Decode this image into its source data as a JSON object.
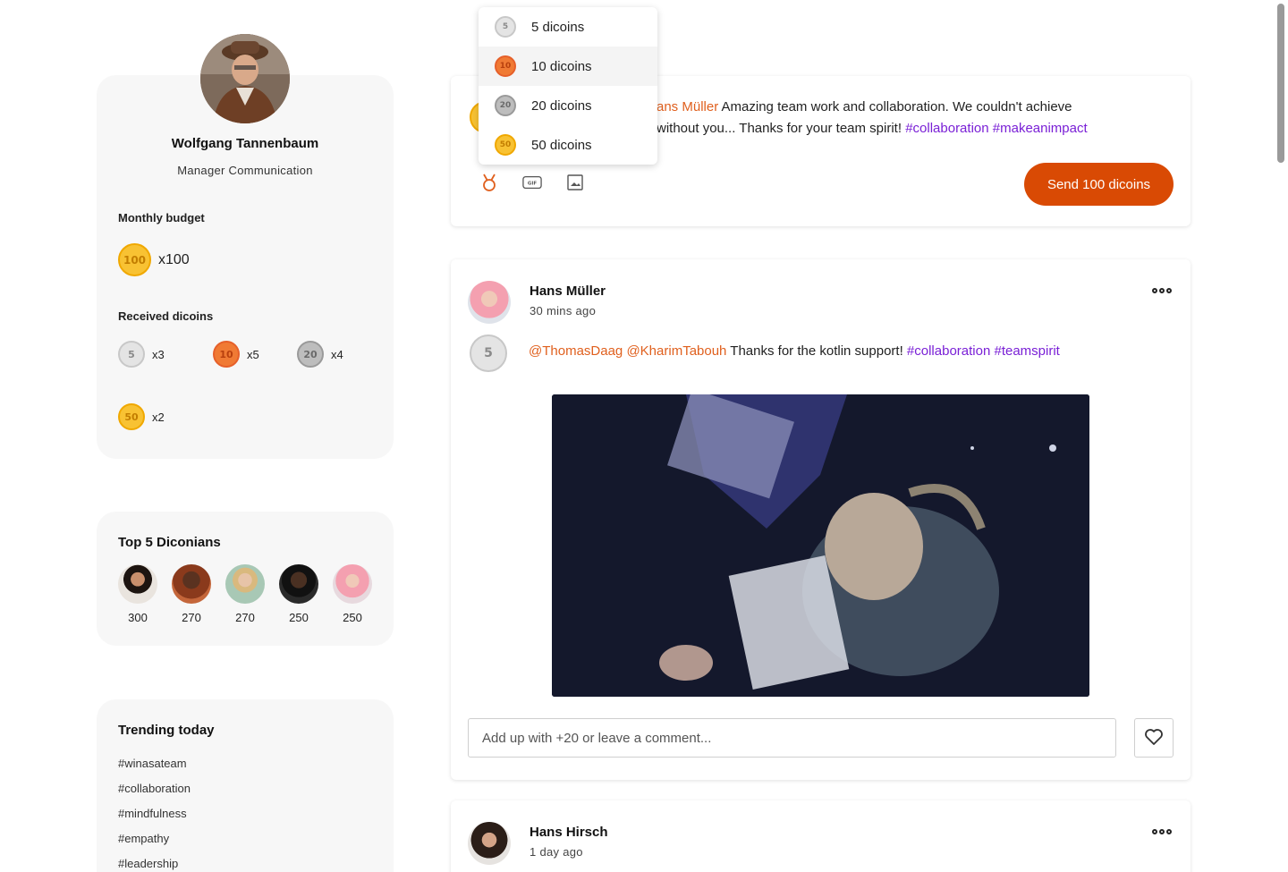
{
  "profile": {
    "name": "Wolfgang Tannenbaum",
    "role": "Manager Communication",
    "budget_label": "Monthly budget",
    "budget_coin": "100",
    "budget_value": "x100",
    "received_label": "Received dicoins",
    "received": [
      {
        "coin": "5",
        "count": "x3"
      },
      {
        "coin": "10",
        "count": "x5"
      },
      {
        "coin": "20",
        "count": "x4"
      },
      {
        "coin": "50",
        "count": "x2"
      }
    ]
  },
  "top5": {
    "title": "Top 5 Diconians",
    "people": [
      {
        "score": "300"
      },
      {
        "score": "270"
      },
      {
        "score": "270"
      },
      {
        "score": "250"
      },
      {
        "score": "250"
      }
    ]
  },
  "trending": {
    "title": "Trending today",
    "tags": [
      "#winasateam",
      "#collaboration",
      "#mindfulness",
      "#empathy",
      "#leadership"
    ]
  },
  "composer": {
    "mention": "Hans Müller",
    "mention_visible": "ans Müller",
    "text_line1": " Amazing team work and collaboration. We couldn't achieve",
    "text_line2": "without you... Thanks for your team spirit! ",
    "hashtag1": "#collaboration",
    "hashtag2": "#makeanimpact",
    "send_label": "Send 100 dicoins"
  },
  "coin_dropdown": {
    "items": [
      {
        "coin": "5",
        "label": "5 dicoins"
      },
      {
        "coin": "10",
        "label": "10 dicoins"
      },
      {
        "coin": "20",
        "label": "20 dicoins"
      },
      {
        "coin": "50",
        "label": "50 dicoins"
      }
    ],
    "selected": "10 dicoins"
  },
  "posts": [
    {
      "author": "Hans Müller",
      "time": "30 mins ago",
      "coin": "5",
      "mention1": "@ThomasDaag",
      "mention2": "@KharimTabouh",
      "text": " Thanks for the kotlin support! ",
      "hashtag1": "#collaboration",
      "hashtag2": "#teamspirit",
      "comment_placeholder": "Add up with +20 or leave a comment..."
    },
    {
      "author": "Hans Hirsch",
      "time": "1 day ago"
    }
  ],
  "colors": {
    "accent": "#d94a04",
    "mention": "#e0601e",
    "hashtag": "#7a20d6",
    "card_bg": "#f7f7f7"
  }
}
